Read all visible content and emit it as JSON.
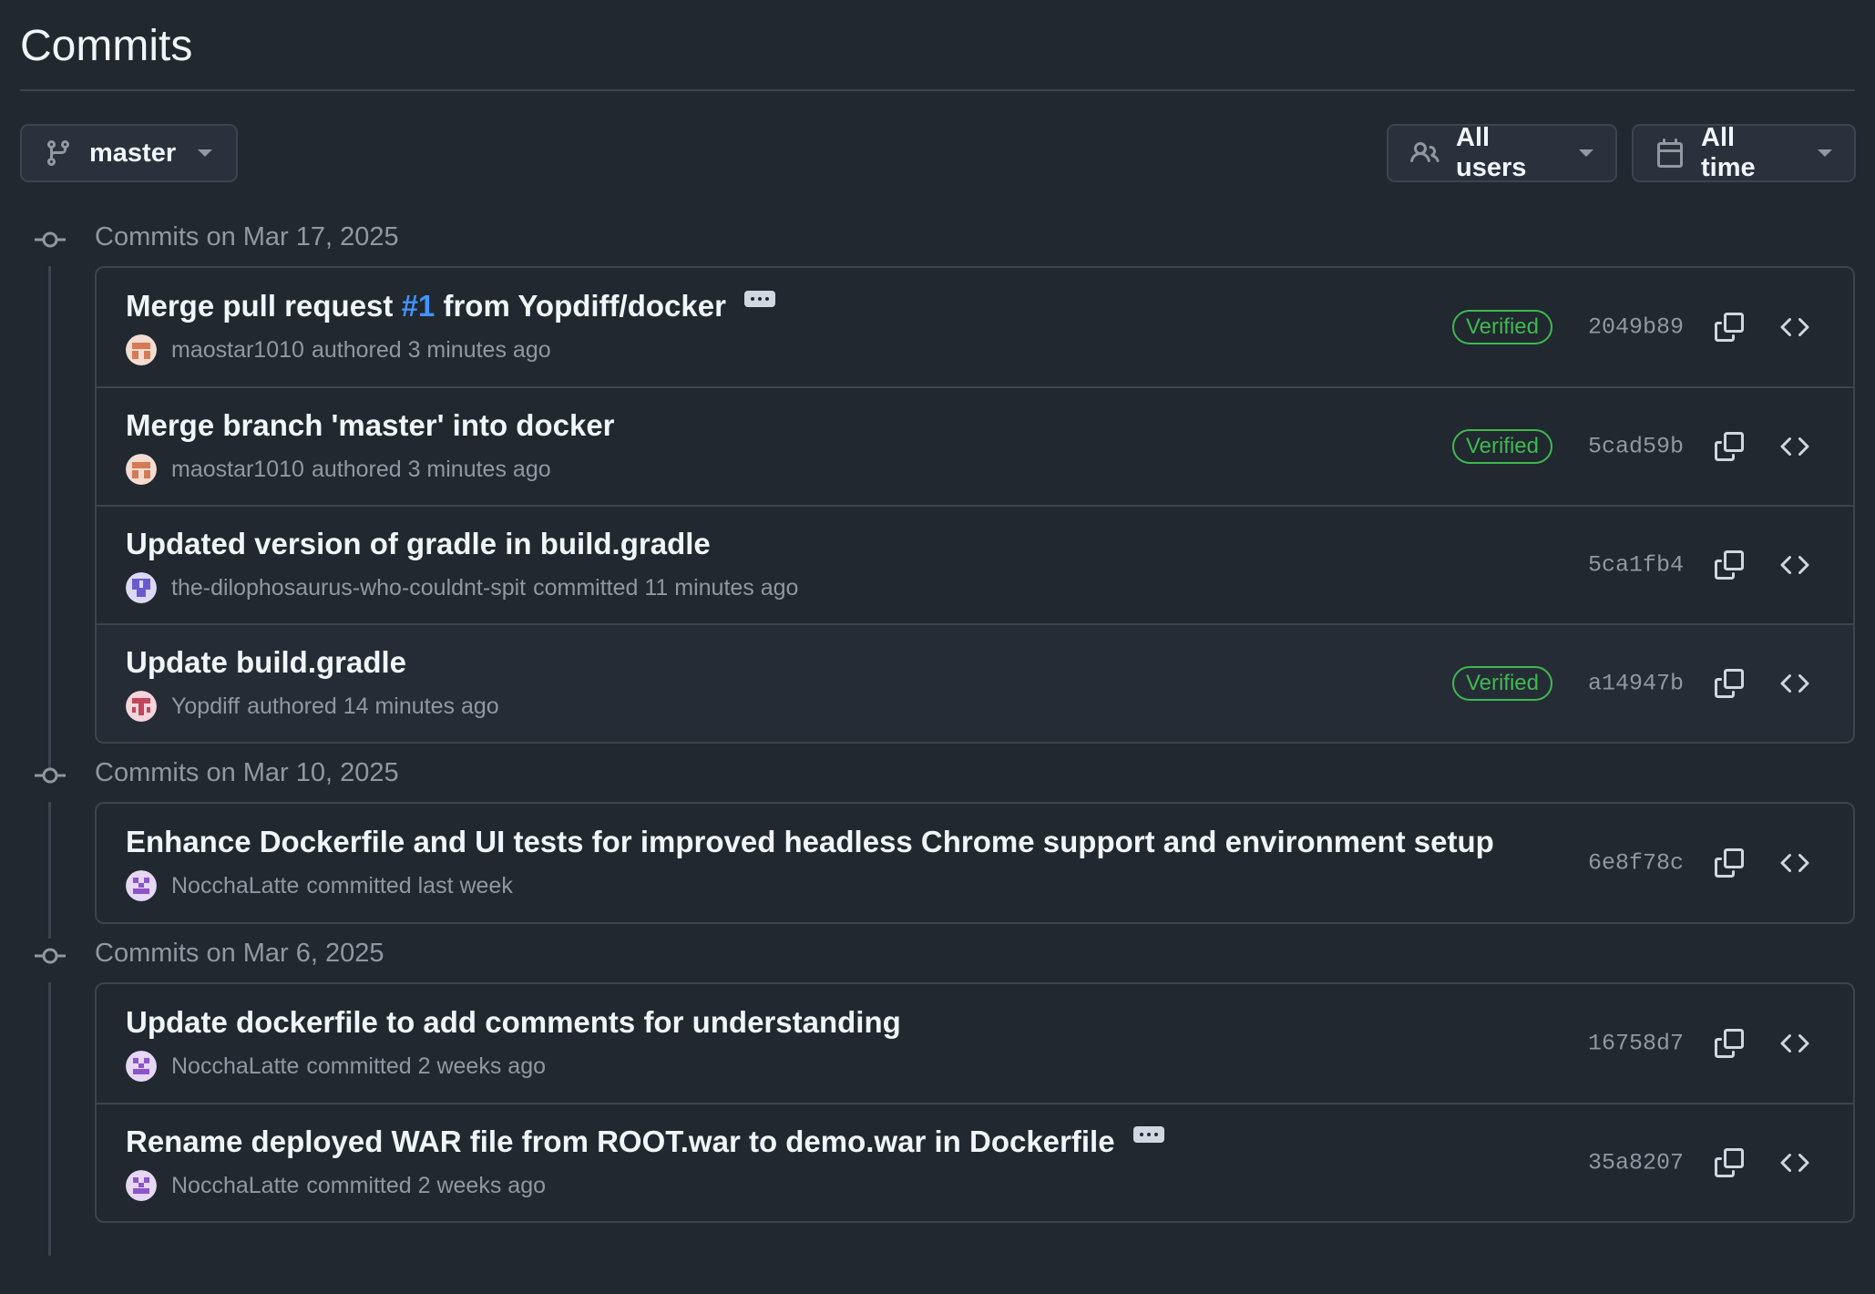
{
  "page": {
    "title": "Commits"
  },
  "toolbar": {
    "branch_label": "master",
    "users_label": "All users",
    "time_label": "All time"
  },
  "colors": {
    "background": "#212830",
    "verified": "#3fb950",
    "link": "#4493f8",
    "border": "#3d444d"
  },
  "groups": [
    {
      "header": "Commits on Mar 17, 2025",
      "commits": [
        {
          "msg_pre": "Merge pull request ",
          "pr": "#1",
          "msg_post": " from Yopdiff/docker",
          "author": "maostar1010",
          "action": "authored 3 minutes ago",
          "verified": "Verified",
          "sha": "2049b89",
          "avatar": "orange-avatar",
          "has_more": true
        },
        {
          "msg_pre": "Merge branch 'master' into docker",
          "author": "maostar1010",
          "action": "authored 3 minutes ago",
          "verified": "Verified",
          "sha": "5cad59b",
          "avatar": "orange-avatar"
        },
        {
          "msg_pre": "Updated version of gradle in build.gradle",
          "author": "the-dilophosaurus-who-couldnt-spit",
          "action": "committed 11 minutes ago",
          "sha": "5ca1fb4",
          "avatar": "purple-avatar"
        },
        {
          "msg_pre": "Update build.gradle",
          "author": "Yopdiff",
          "action": "authored 14 minutes ago",
          "verified": "Verified",
          "sha": "a14947b",
          "avatar": "red-avatar"
        }
      ]
    },
    {
      "header": "Commits on Mar 10, 2025",
      "commits": [
        {
          "msg_pre": "Enhance Dockerfile and UI tests for improved headless Chrome support and environment setup",
          "author": "NocchaLatte",
          "action": "committed last week",
          "sha": "6e8f78c",
          "avatar": "violet-avatar"
        }
      ]
    },
    {
      "header": "Commits on Mar 6, 2025",
      "commits": [
        {
          "msg_pre": "Update dockerfile to add comments for understanding",
          "author": "NocchaLatte",
          "action": "committed 2 weeks ago",
          "sha": "16758d7",
          "avatar": "violet-avatar"
        },
        {
          "msg_pre": "Rename deployed WAR file from ROOT.war to demo.war in Dockerfile",
          "author": "NocchaLatte",
          "action": "committed 2 weeks ago",
          "sha": "35a8207",
          "avatar": "violet-avatar",
          "has_more": true
        }
      ]
    }
  ]
}
